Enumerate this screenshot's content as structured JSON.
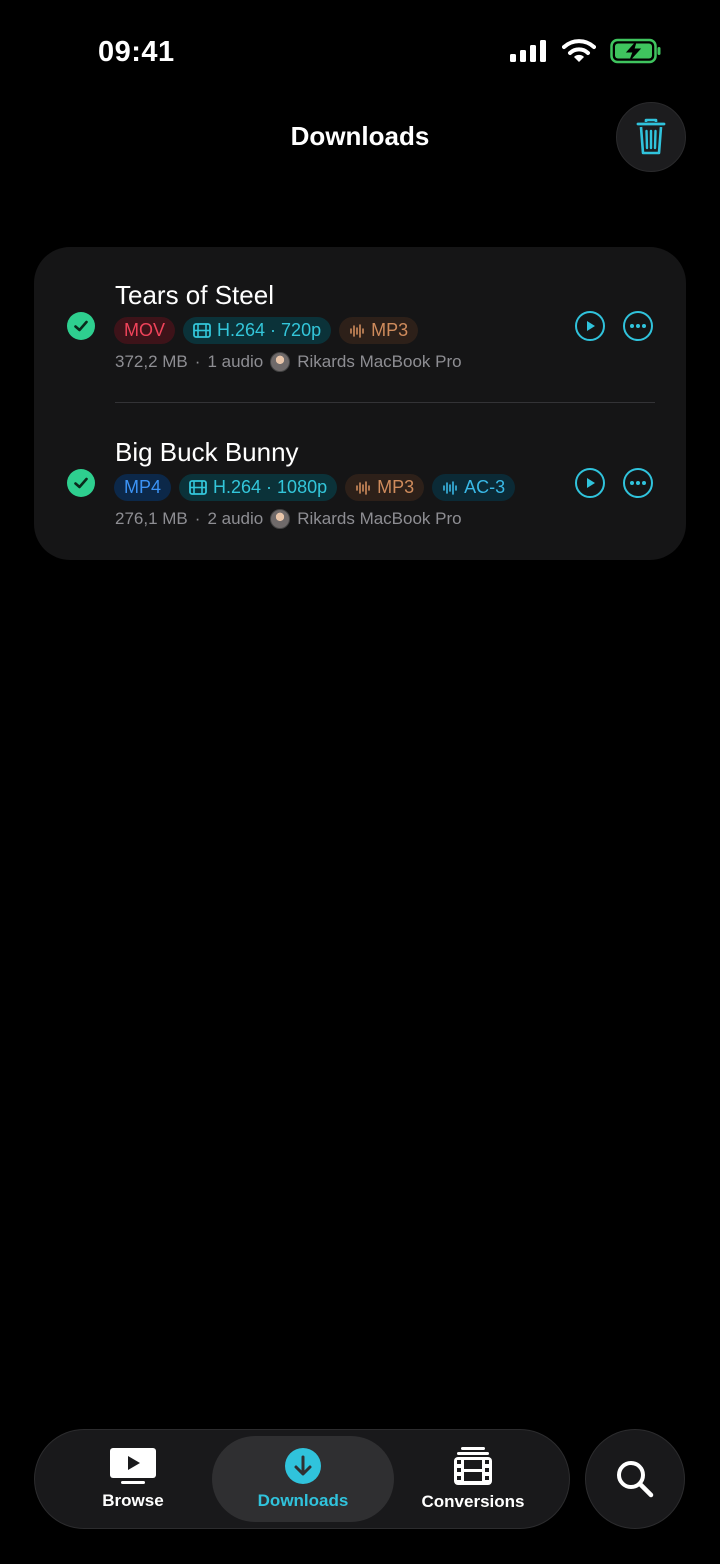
{
  "status_bar": {
    "time": "09:41"
  },
  "header": {
    "title": "Downloads"
  },
  "downloads": [
    {
      "title": "Tears of Steel",
      "container": "MOV",
      "video": "H.264 · 720p",
      "audio_tracks": [
        "MP3"
      ],
      "size": "372,2 MB",
      "audio_count": "1 audio",
      "device": "Rikards MacBook Pro"
    },
    {
      "title": "Big Buck Bunny",
      "container": "MP4",
      "video": "H.264 · 1080p",
      "audio_tracks": [
        "MP3",
        "AC-3"
      ],
      "size": "276,1 MB",
      "audio_count": "2 audio",
      "device": "Rikards MacBook Pro"
    }
  ],
  "separator": "·",
  "tabbar": {
    "browse": "Browse",
    "downloads": "Downloads",
    "conversions": "Conversions"
  },
  "colors": {
    "accent": "#30c3dc",
    "success": "#2ecf8f",
    "background": "#000000",
    "card": "#151516"
  },
  "icons": [
    "trash-icon",
    "checkmark-icon",
    "play-icon",
    "more-icon",
    "film-icon",
    "waveform-icon",
    "tv-icon",
    "download-icon",
    "conversions-icon",
    "search-icon"
  ]
}
